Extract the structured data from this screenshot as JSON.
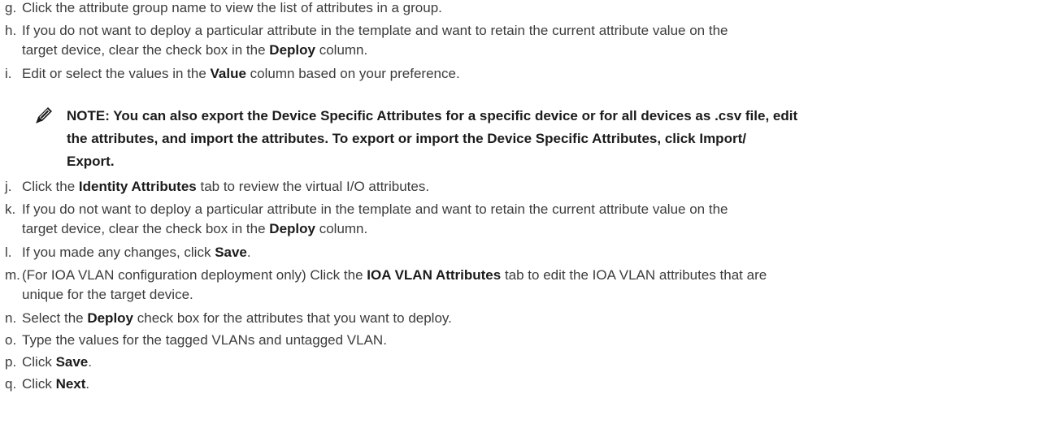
{
  "steps_before_note": [
    {
      "letter": "g.",
      "lines": [
        [
          "Click the attribute group name to view the list of attributes in a group.",
          "",
          ""
        ]
      ]
    },
    {
      "letter": "h.",
      "lines": [
        [
          "If you do not want to deploy a particular attribute in the template and want to retain the current attribute value on the",
          "",
          ""
        ],
        [
          "target device, clear the check box in the ",
          "Deploy",
          " column."
        ]
      ]
    },
    {
      "letter": "i.",
      "lines": [
        [
          "Edit or select the values in the ",
          "Value",
          " column based on your preference."
        ]
      ]
    }
  ],
  "note": {
    "lines": [
      "NOTE: You can also export the Device Specific Attributes for a specific device or for all devices as .csv file, edit",
      "the attributes, and import the attributes. To export or import the Device Specific Attributes, click Import/",
      "Export."
    ]
  },
  "steps_after_note": [
    {
      "letter": "j.",
      "lines": [
        [
          "Click the ",
          "Identity Attributes",
          " tab to review the virtual I/O attributes."
        ]
      ]
    },
    {
      "letter": "k.",
      "lines": [
        [
          "If you do not want to deploy a particular attribute in the template and want to retain the current attribute value on the",
          "",
          ""
        ],
        [
          "target device, clear the check box in the ",
          "Deploy",
          " column."
        ]
      ]
    },
    {
      "letter": "l.",
      "lines": [
        [
          "If you made any changes, click ",
          "Save",
          "."
        ]
      ]
    },
    {
      "letter": "m.",
      "lines": [
        [
          "(For IOA VLAN configuration deployment only) Click the ",
          "IOA VLAN Attributes",
          " tab to edit the IOA VLAN attributes that are"
        ],
        [
          "unique for the target device.",
          "",
          ""
        ]
      ]
    },
    {
      "letter": "n.",
      "lines": [
        [
          "Select the ",
          "Deploy",
          " check box for the attributes that you want to deploy."
        ]
      ]
    },
    {
      "letter": "o.",
      "lines": [
        [
          "Type the values for the tagged VLANs and untagged VLAN.",
          "",
          ""
        ]
      ]
    },
    {
      "letter": "p.",
      "lines": [
        [
          "Click ",
          "Save",
          "."
        ]
      ]
    },
    {
      "letter": "q.",
      "lines": [
        [
          "Click ",
          "Next",
          "."
        ]
      ]
    }
  ]
}
